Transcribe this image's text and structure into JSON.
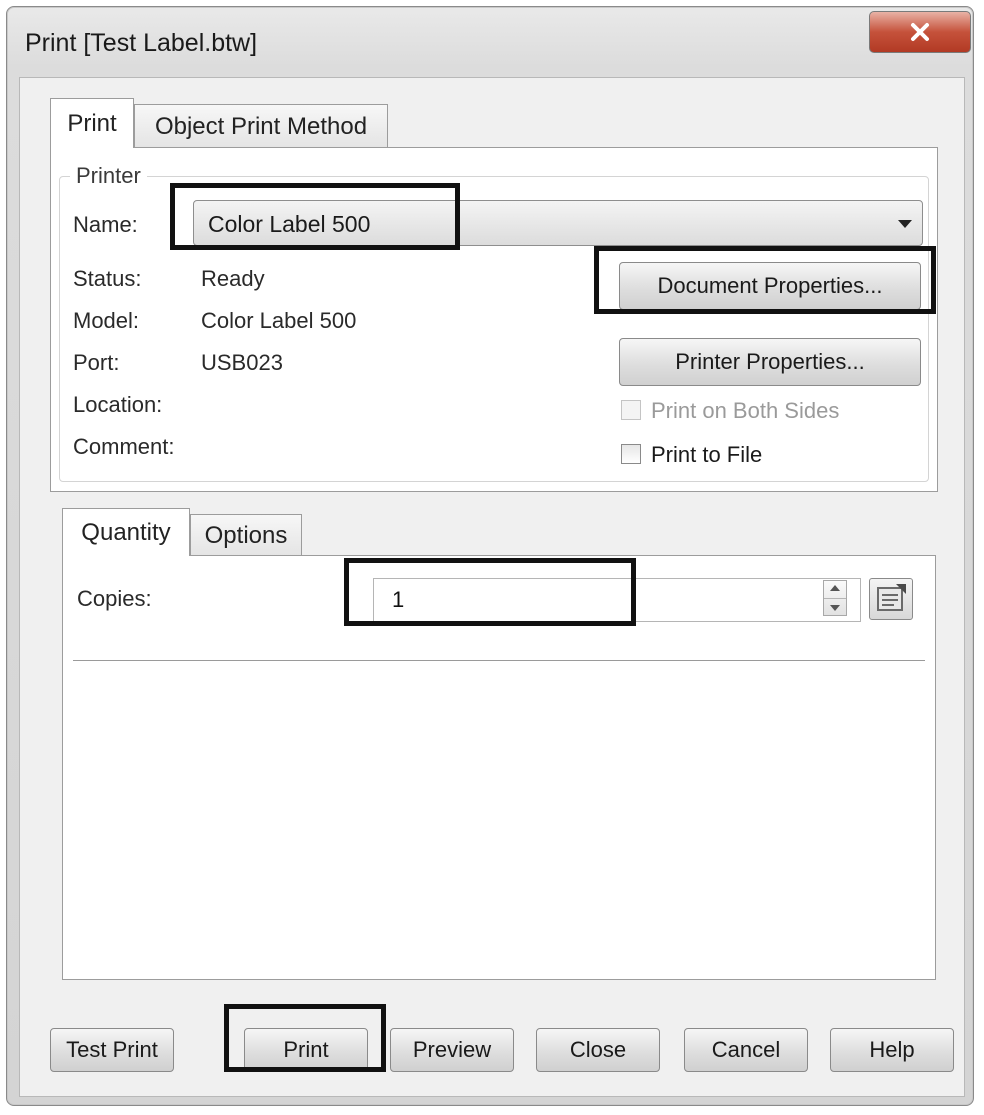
{
  "window": {
    "title": "Print [Test Label.btw]",
    "close_glyph": "✕"
  },
  "tabs_top": [
    "Print",
    "Object Print Method"
  ],
  "printer": {
    "group_title": "Printer",
    "name_label": "Name:",
    "name_value": "Color Label 500",
    "status_label": "Status:",
    "status_value": "Ready",
    "model_label": "Model:",
    "model_value": "Color Label 500",
    "port_label": "Port:",
    "port_value": "USB023",
    "location_label": "Location:",
    "location_value": "",
    "comment_label": "Comment:",
    "comment_value": "",
    "document_properties_label": "Document Properties...",
    "printer_properties_label": "Printer Properties...",
    "print_both_sides_label": "Print on Both Sides",
    "print_to_file_label": "Print to File",
    "print_both_sides_checked": false,
    "print_to_file_checked": false
  },
  "tabs_bottom": [
    "Quantity",
    "Options"
  ],
  "quantity": {
    "copies_label": "Copies:",
    "copies_value": "1"
  },
  "footer_buttons": {
    "test_print": "Test Print",
    "print": "Print",
    "preview": "Preview",
    "close": "Close",
    "cancel": "Cancel",
    "help": "Help"
  },
  "icons": {
    "close": "close-icon",
    "dropdown": "chevron-down-icon",
    "spinner": "spinner-icon",
    "variable": "data-source-icon"
  },
  "colors": {
    "close_button": "#c5523b",
    "highlight_box": "#111111",
    "dialog_background": "#f0f0f0"
  }
}
